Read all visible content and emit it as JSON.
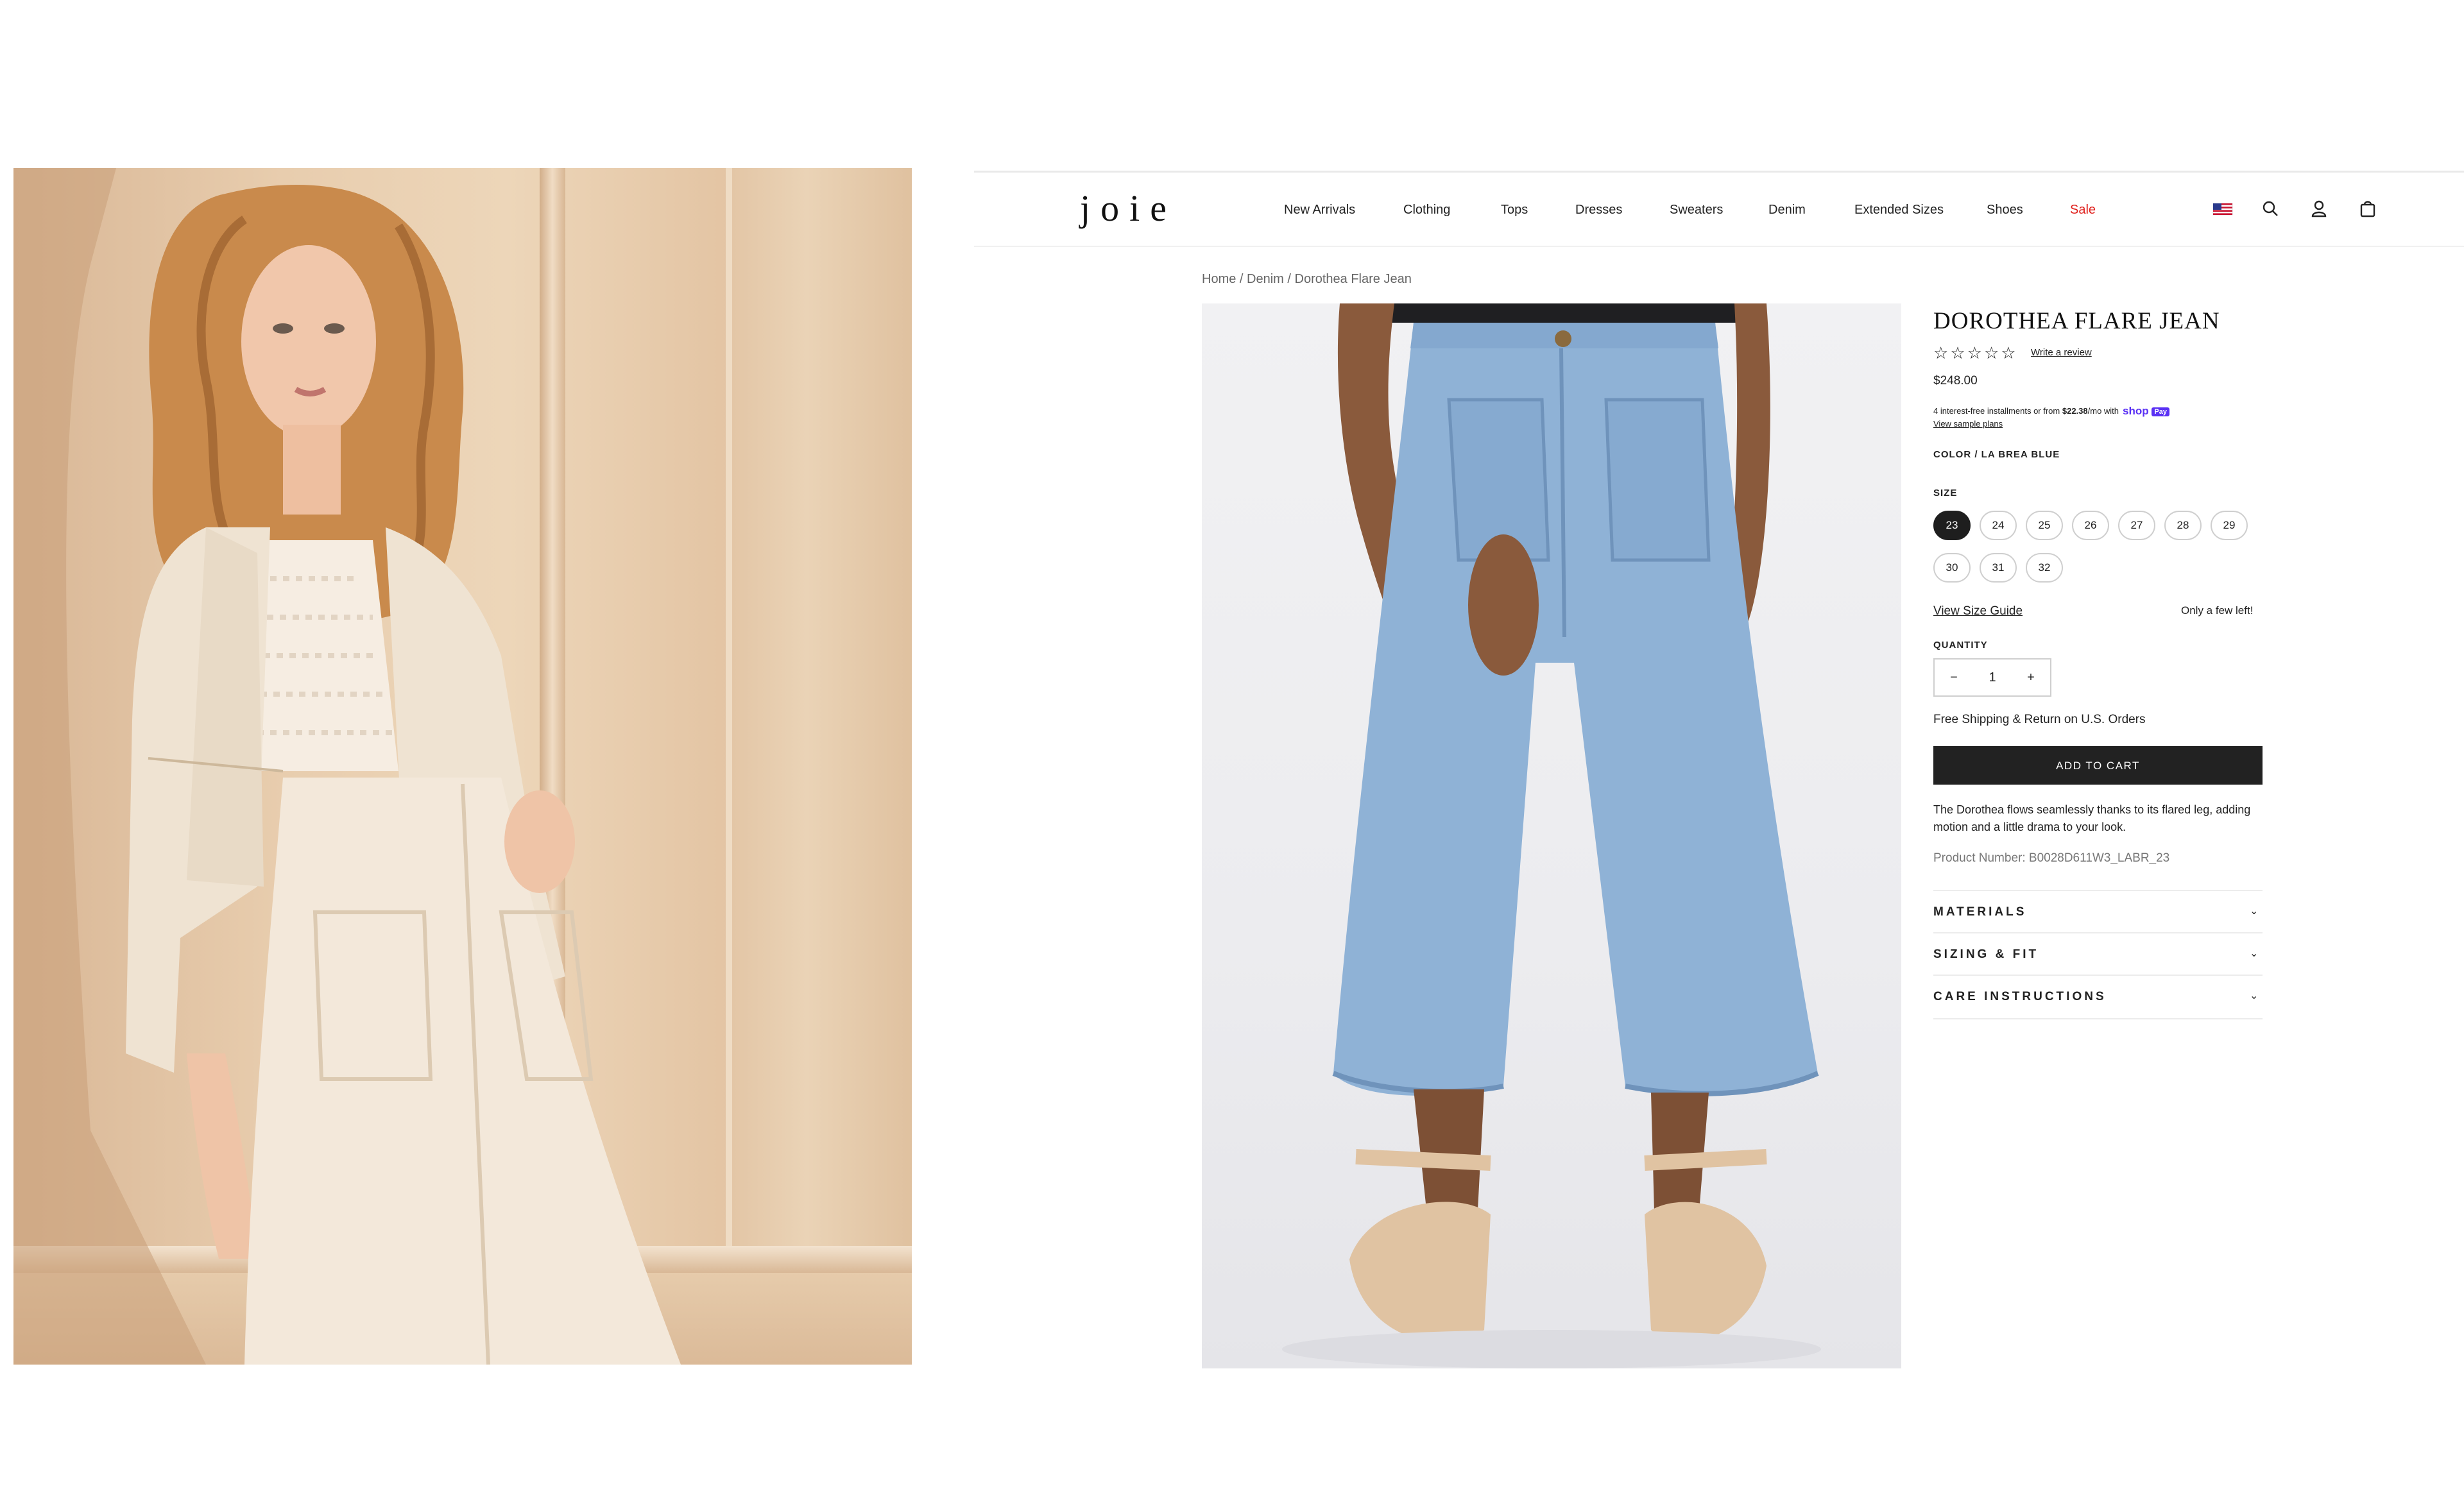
{
  "site": {
    "logo": "joie",
    "nav": [
      {
        "label": "New Arrivals"
      },
      {
        "label": "Clothing"
      },
      {
        "label": "Tops"
      },
      {
        "label": "Dresses"
      },
      {
        "label": "Sweaters"
      },
      {
        "label": "Denim"
      },
      {
        "label": "Extended Sizes"
      },
      {
        "label": "Shoes"
      },
      {
        "label": "Sale"
      }
    ],
    "header_icons": [
      "us-flag-icon",
      "search-icon",
      "account-icon",
      "cart-icon"
    ]
  },
  "breadcrumb": {
    "home": "Home",
    "sep1": " / ",
    "category": "Denim",
    "sep2": " / ",
    "current": "Dorothea Flare Jean"
  },
  "product": {
    "title": "DOROTHEA FLARE JEAN",
    "stars": [
      "☆",
      "☆",
      "☆",
      "☆",
      "☆"
    ],
    "write_review": "Write a review",
    "price": "$248.00",
    "installments_prefix": "4 interest-free installments or from ",
    "installments_amount": "$22.38",
    "installments_suffix": "/mo with",
    "shop_pay_shop": "shop",
    "shop_pay_pay": "Pay",
    "view_sample_plans": "View sample plans",
    "color_label": "COLOR / LA BREA BLUE",
    "size_label": "SIZE",
    "sizes": [
      {
        "label": "23",
        "selected": true
      },
      {
        "label": "24",
        "selected": false
      },
      {
        "label": "25",
        "selected": false
      },
      {
        "label": "26",
        "selected": false
      },
      {
        "label": "27",
        "selected": false
      },
      {
        "label": "28",
        "selected": false
      },
      {
        "label": "29",
        "selected": false
      },
      {
        "label": "30",
        "selected": false
      },
      {
        "label": "31",
        "selected": false
      },
      {
        "label": "32",
        "selected": false
      }
    ],
    "size_guide": "View Size Guide",
    "stock_note": "Only a few left!",
    "quantity_label": "QUANTITY",
    "quantity": {
      "minus": "−",
      "value": "1",
      "plus": "+"
    },
    "free_shipping": "Free Shipping & Return on U.S. Orders",
    "add_to_cart": "ADD TO CART",
    "description": "The Dorothea flows seamlessly thanks to its flared leg, adding motion and a little drama to your look.",
    "product_number": "Product Number: B0028D611W3_LABR_23",
    "accordion": [
      {
        "title": "MATERIALS",
        "chevron": "⌄"
      },
      {
        "title": "SIZING & FIT",
        "chevron": "⌄"
      },
      {
        "title": "CARE INSTRUCTIONS",
        "chevron": "⌄"
      }
    ]
  },
  "colors": {
    "text": "#1e1e1e",
    "sale": "#e0201c",
    "button_bg": "#222222",
    "shop_pay": "#5a31f4",
    "denim": "#8fb2d6",
    "backdrop": "#d9b796"
  }
}
